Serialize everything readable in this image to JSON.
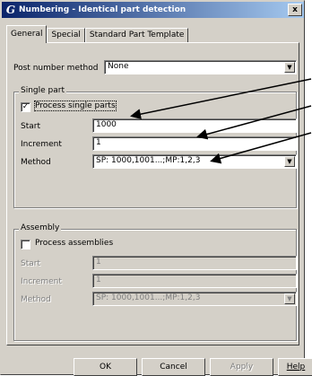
{
  "window": {
    "title": "Numbering - Identical part detection",
    "close_glyph": "x"
  },
  "tabs": [
    "General",
    "Special",
    "Standard Part Template"
  ],
  "general": {
    "post_number_label": "Post number method",
    "post_number_value": "None"
  },
  "single_part": {
    "group_label": "Single part",
    "checkbox_label": "Process single parts",
    "checked": true,
    "start_label": "Start",
    "start_value": "1000",
    "increment_label": "Increment",
    "increment_value": "1",
    "method_label": "Method",
    "method_value": "SP: 1000,1001...;MP:1,2,3"
  },
  "assembly": {
    "group_label": "Assembly",
    "checkbox_label": "Process assemblies",
    "checked": false,
    "start_label": "Start",
    "start_value": "1",
    "increment_label": "Increment",
    "increment_value": "1",
    "method_label": "Method",
    "method_value": "SP: 1000,1001...;MP:1,2,3"
  },
  "buttons": {
    "ok": "OK",
    "cancel": "Cancel",
    "apply": "Apply",
    "help": "Help"
  },
  "colors": {
    "title_start": "#0a246a",
    "title_end": "#a6caf0",
    "face": "#d4d0c8"
  }
}
